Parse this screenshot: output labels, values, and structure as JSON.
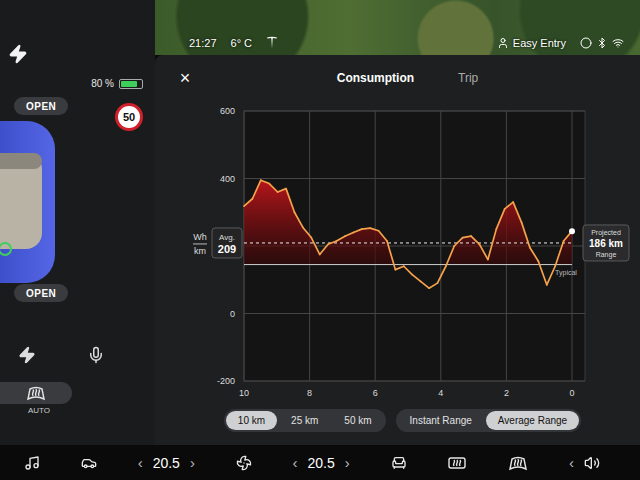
{
  "status_bar": {
    "time": "21:27",
    "temperature": "6° C",
    "profile": "Easy Entry"
  },
  "left_panel": {
    "battery": {
      "reading": "80 %",
      "level": 0.8
    },
    "speed_limit": "50",
    "doors": [
      {
        "label": "OPEN"
      },
      {
        "label": "OPEN"
      }
    ],
    "defrost": {
      "label": "AUTO"
    }
  },
  "popup": {
    "close": "×",
    "tabs": [
      {
        "label": "Consumption",
        "selected": true
      },
      {
        "label": "Trip",
        "selected": false
      }
    ]
  },
  "chart": {
    "unit_top": "Wh",
    "unit_bottom": "km",
    "y_ticks": [
      {
        "label": "600",
        "value": 600
      },
      {
        "label": "400",
        "value": 400
      },
      {
        "label": "0",
        "value": 0
      },
      {
        "label": "-200",
        "value": -200
      }
    ],
    "x_ticks": [
      {
        "label": "10",
        "value": 10
      },
      {
        "label": "8",
        "value": 8
      },
      {
        "label": "6",
        "value": 6
      },
      {
        "label": "4",
        "value": 4
      },
      {
        "label": "2",
        "value": 2
      },
      {
        "label": "0",
        "value": 0
      }
    ],
    "x_max": 10,
    "series": [
      {
        "name": "consumption",
        "values": [
          318,
          340,
          395,
          385,
          360,
          370,
          300,
          255,
          225,
          175,
          205,
          215,
          229,
          240,
          250,
          253,
          245,
          215,
          130,
          140,
          115,
          95,
          75,
          90,
          140,
          200,
          225,
          229,
          205,
          160,
          250,
          310,
          330,
          270,
          195,
          155,
          85,
          140,
          215,
          244
        ]
      }
    ],
    "average": {
      "label": "Avg.",
      "value": "209"
    },
    "typical": {
      "label": "Typical",
      "value": 145
    },
    "projected": {
      "title": "Projected",
      "value": "186 km",
      "caption": "Range"
    }
  },
  "distance_buttons": [
    {
      "label": "10 km",
      "selected": true
    },
    {
      "label": "25 km",
      "selected": false
    },
    {
      "label": "50 km",
      "selected": false
    }
  ],
  "range_modes": [
    {
      "label": "Instant Range",
      "selected": false
    },
    {
      "label": "Average Range",
      "selected": true
    }
  ],
  "bottom_bar": {
    "climate": [
      {
        "left": "‹",
        "value": "20.5",
        "right": "›"
      },
      {
        "left": "‹",
        "value": "20.5",
        "right": "›"
      }
    ],
    "volume": "‹"
  }
}
